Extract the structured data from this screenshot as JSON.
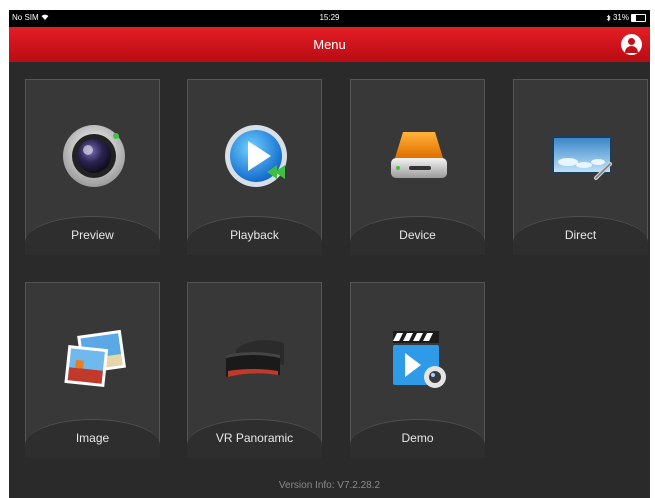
{
  "statusbar": {
    "carrier": "No SIM",
    "wifi_icon": "wifi-icon",
    "time": "15:29",
    "bluetooth_icon": "bluetooth-icon",
    "battery": "31%",
    "battery_level": 0.31
  },
  "navbar": {
    "title": "Menu",
    "user_icon": "user-icon",
    "bar_color": "#d1151c"
  },
  "menu": {
    "items": [
      {
        "label": "Preview",
        "icon": "camera-icon"
      },
      {
        "label": "Playback",
        "icon": "playback-icon"
      },
      {
        "label": "Device",
        "icon": "hard-drive-icon"
      },
      {
        "label": "Direct",
        "icon": "direct-icon"
      },
      {
        "label": "Image",
        "icon": "photos-icon"
      },
      {
        "label": "VR Panoramic",
        "icon": "vr-headset-icon"
      },
      {
        "label": "Demo",
        "icon": "demo-video-icon"
      }
    ]
  },
  "footer": {
    "version": "Version Info: V7.2.28.2"
  }
}
